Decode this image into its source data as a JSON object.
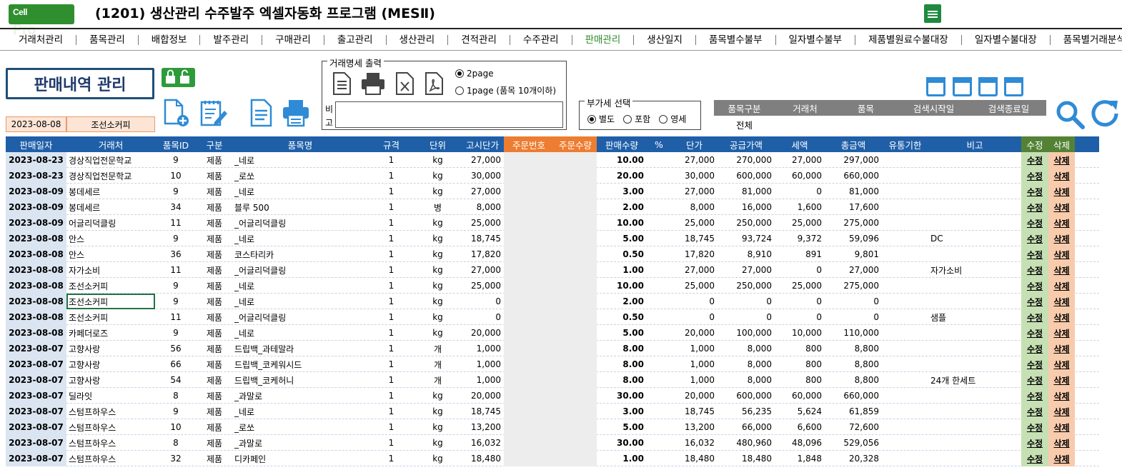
{
  "app": {
    "logo": "CellPro",
    "title": "(1201) 생산관리 수주발주 엑셀자동화 프로그램 (MESⅡ)"
  },
  "menu": [
    "거래처관리",
    "품목관리",
    "배합정보",
    "발주관리",
    "구매관리",
    "출고관리",
    "생산관리",
    "견적관리",
    "수주관리",
    "판매관리",
    "생산일지",
    "품목별수불부",
    "일자별수불부",
    "제품별원료수불대장",
    "일자별수불대장",
    "품목별거래분석"
  ],
  "menu_active": "판매관리",
  "page": {
    "title": "판매내역 관리",
    "date": "2023-08-08",
    "vendor": "조선소커피"
  },
  "invoice": {
    "legend": "거래명세 출력",
    "option_2page": "2page",
    "option_1page": "1page (품목 10개이하)",
    "memo_label": "비고",
    "memo_value": ""
  },
  "vat": {
    "legend": "부가세 선택",
    "options": [
      "별도",
      "포함",
      "영세"
    ],
    "selected": "별도"
  },
  "filter": {
    "headers": [
      "품목구분",
      "거래처",
      "품목",
      "검색시작일",
      "검색종료일"
    ],
    "values": [
      "전체",
      "",
      "",
      "",
      ""
    ]
  },
  "table": {
    "headers": [
      "판매일자",
      "거래처",
      "품목ID",
      "구분",
      "품목명",
      "규격",
      "단위",
      "고시단가",
      "주문번호",
      "주문수량",
      "판매수량",
      "%",
      "단가",
      "공급가액",
      "세액",
      "총금액",
      "유통기한",
      "비고",
      "수정",
      "삭제"
    ],
    "rows": [
      [
        "2023-08-23",
        "경상직업전문학교",
        "9",
        "제품",
        "_네로",
        "1",
        "kg",
        "27,000",
        "",
        "",
        "10.00",
        "",
        "27,000",
        "270,000",
        "27,000",
        "297,000",
        "",
        "",
        "수정",
        "삭제"
      ],
      [
        "2023-08-23",
        "경상직업전문학교",
        "10",
        "제품",
        "_로쏘",
        "1",
        "kg",
        "30,000",
        "",
        "",
        "20.00",
        "",
        "30,000",
        "600,000",
        "60,000",
        "660,000",
        "",
        "",
        "수정",
        "삭제"
      ],
      [
        "2023-08-09",
        "봉데세르",
        "9",
        "제품",
        "_네로",
        "1",
        "kg",
        "27,000",
        "",
        "",
        "3.00",
        "",
        "27,000",
        "81,000",
        "0",
        "81,000",
        "",
        "",
        "수정",
        "삭제"
      ],
      [
        "2023-08-09",
        "봉데세르",
        "34",
        "제품",
        "블루 500",
        "1",
        "병",
        "8,000",
        "",
        "",
        "2.00",
        "",
        "8,000",
        "16,000",
        "1,600",
        "17,600",
        "",
        "",
        "수정",
        "삭제"
      ],
      [
        "2023-08-09",
        "어글리덕클링",
        "11",
        "제품",
        "_어글리덕클링",
        "1",
        "kg",
        "25,000",
        "",
        "",
        "10.00",
        "",
        "25,000",
        "250,000",
        "25,000",
        "275,000",
        "",
        "",
        "수정",
        "삭제"
      ],
      [
        "2023-08-08",
        "안스",
        "9",
        "제품",
        "_네로",
        "1",
        "kg",
        "18,745",
        "",
        "",
        "5.00",
        "",
        "18,745",
        "93,724",
        "9,372",
        "59,096",
        "",
        "DC",
        "수정",
        "삭제"
      ],
      [
        "2023-08-08",
        "안스",
        "36",
        "제품",
        "코스타리카",
        "1",
        "kg",
        "17,820",
        "",
        "",
        "0.50",
        "",
        "17,820",
        "8,910",
        "891",
        "9,801",
        "",
        "",
        "수정",
        "삭제"
      ],
      [
        "2023-08-08",
        "자가소비",
        "11",
        "제품",
        "_어글리덕클링",
        "1",
        "kg",
        "27,000",
        "",
        "",
        "1.00",
        "",
        "27,000",
        "27,000",
        "0",
        "27,000",
        "",
        "자가소비",
        "수정",
        "삭제"
      ],
      [
        "2023-08-08",
        "조선소커피",
        "9",
        "제품",
        "_네로",
        "1",
        "kg",
        "25,000",
        "",
        "",
        "10.00",
        "",
        "25,000",
        "250,000",
        "25,000",
        "275,000",
        "",
        "",
        "수정",
        "삭제"
      ],
      [
        "2023-08-08",
        "조선소커피",
        "9",
        "제품",
        "_네로",
        "1",
        "kg",
        "0",
        "",
        "",
        "2.00",
        "",
        "0",
        "0",
        "0",
        "0",
        "",
        "",
        "수정",
        "삭제"
      ],
      [
        "2023-08-08",
        "조선소커피",
        "11",
        "제품",
        "_어글리덕클링",
        "1",
        "kg",
        "0",
        "",
        "",
        "0.50",
        "",
        "0",
        "0",
        "0",
        "0",
        "",
        "샘플",
        "수정",
        "삭제"
      ],
      [
        "2023-08-08",
        "카페더로즈",
        "9",
        "제품",
        "_네로",
        "1",
        "kg",
        "20,000",
        "",
        "",
        "5.00",
        "",
        "20,000",
        "100,000",
        "10,000",
        "110,000",
        "",
        "",
        "수정",
        "삭제"
      ],
      [
        "2023-08-07",
        "고향사랑",
        "56",
        "제품",
        "드립백_과테말라",
        "1",
        "개",
        "1,000",
        "",
        "",
        "8.00",
        "",
        "1,000",
        "8,000",
        "800",
        "8,800",
        "",
        "",
        "수정",
        "삭제"
      ],
      [
        "2023-08-07",
        "고향사랑",
        "66",
        "제품",
        "드립백_코케워시드",
        "1",
        "개",
        "1,000",
        "",
        "",
        "8.00",
        "",
        "1,000",
        "8,000",
        "800",
        "8,800",
        "",
        "",
        "수정",
        "삭제"
      ],
      [
        "2023-08-07",
        "고향사랑",
        "54",
        "제품",
        "드립백_코케허니",
        "1",
        "개",
        "1,000",
        "",
        "",
        "8.00",
        "",
        "1,000",
        "8,000",
        "800",
        "8,800",
        "",
        "24개 한세트",
        "수정",
        "삭제"
      ],
      [
        "2023-08-07",
        "딜라잇",
        "8",
        "제품",
        "_과말로",
        "1",
        "kg",
        "20,000",
        "",
        "",
        "30.00",
        "",
        "20,000",
        "600,000",
        "60,000",
        "660,000",
        "",
        "",
        "수정",
        "삭제"
      ],
      [
        "2023-08-07",
        "스텀프하우스",
        "9",
        "제품",
        "_네로",
        "1",
        "kg",
        "18,745",
        "",
        "",
        "3.00",
        "",
        "18,745",
        "56,235",
        "5,624",
        "61,859",
        "",
        "",
        "수정",
        "삭제"
      ],
      [
        "2023-08-07",
        "스텀프하우스",
        "10",
        "제품",
        "_로쏘",
        "1",
        "kg",
        "13,200",
        "",
        "",
        "5.00",
        "",
        "13,200",
        "66,000",
        "6,600",
        "72,600",
        "",
        "",
        "수정",
        "삭제"
      ],
      [
        "2023-08-07",
        "스텀프하우스",
        "8",
        "제품",
        "_과말로",
        "1",
        "kg",
        "16,032",
        "",
        "",
        "30.00",
        "",
        "16,032",
        "480,960",
        "48,096",
        "529,056",
        "",
        "",
        "수정",
        "삭제"
      ],
      [
        "2023-08-07",
        "스텀프하우스",
        "32",
        "제품",
        "디카페인",
        "1",
        "kg",
        "18,480",
        "",
        "",
        "1.00",
        "",
        "18,480",
        "18,480",
        "1,848",
        "20,328",
        "",
        "",
        "수정",
        "삭제"
      ]
    ]
  },
  "colors": {
    "header_blue": "#1f5fa8",
    "order_orange": "#ed7d31",
    "edit_green": "#c6e0b4",
    "delete_salmon": "#f8cbad",
    "active_menu": "#2e8b2e"
  }
}
